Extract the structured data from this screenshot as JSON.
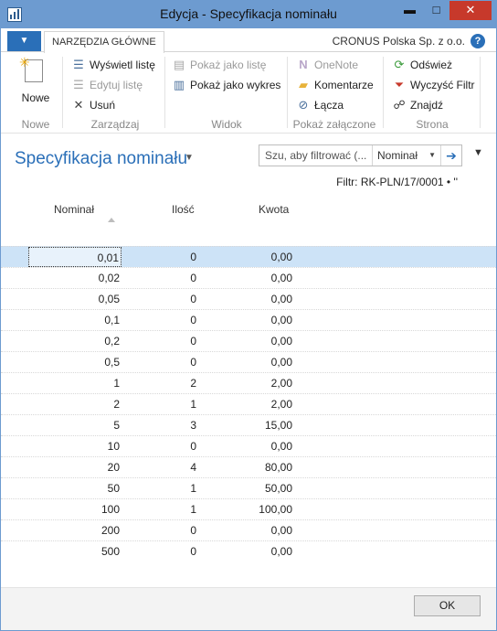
{
  "window": {
    "title": "Edycja - Specyfikacja nominału",
    "minimize": "▬",
    "maximize": "□",
    "close": "✕"
  },
  "ribbon": {
    "app_menu_icon": "▼",
    "tab": "NARZĘDZIA GŁÓWNE",
    "company": "CRONUS Polska Sp. z o.o.",
    "help": "?",
    "groups": {
      "new": {
        "label": "Nowe",
        "new_button": "Nowe"
      },
      "manage": {
        "label": "Zarządzaj",
        "view_list": "Wyświetl listę",
        "edit_list": "Edytuj listę",
        "delete": "Usuń"
      },
      "view": {
        "label": "Widok",
        "show_as_list": "Pokaż jako listę",
        "show_as_chart": "Pokaż jako wykres"
      },
      "attachments": {
        "label": "Pokaż załączone",
        "onenote": "OneNote",
        "comments": "Komentarze",
        "links": "Łącza"
      },
      "page": {
        "label": "Strona",
        "refresh": "Odśwież",
        "clear_filter": "Wyczyść Filtr",
        "find": "Znajdź"
      }
    }
  },
  "page": {
    "title": "Specyfikacja nominału",
    "filter_placeholder": "Szu, aby filtrować (...",
    "filter_field": "Nominał",
    "filter_text": "Filtr: RK-PLN/17/0001 • ''"
  },
  "table": {
    "columns": [
      "Nominał",
      "Ilość",
      "Kwota"
    ],
    "rows": [
      {
        "nominal": "0,01",
        "qty": "0",
        "amount": "0,00"
      },
      {
        "nominal": "0,02",
        "qty": "0",
        "amount": "0,00"
      },
      {
        "nominal": "0,05",
        "qty": "0",
        "amount": "0,00"
      },
      {
        "nominal": "0,1",
        "qty": "0",
        "amount": "0,00"
      },
      {
        "nominal": "0,2",
        "qty": "0",
        "amount": "0,00"
      },
      {
        "nominal": "0,5",
        "qty": "0",
        "amount": "0,00"
      },
      {
        "nominal": "1",
        "qty": "2",
        "amount": "2,00"
      },
      {
        "nominal": "2",
        "qty": "1",
        "amount": "2,00"
      },
      {
        "nominal": "5",
        "qty": "3",
        "amount": "15,00"
      },
      {
        "nominal": "10",
        "qty": "0",
        "amount": "0,00"
      },
      {
        "nominal": "20",
        "qty": "4",
        "amount": "80,00"
      },
      {
        "nominal": "50",
        "qty": "1",
        "amount": "50,00"
      },
      {
        "nominal": "100",
        "qty": "1",
        "amount": "100,00"
      },
      {
        "nominal": "200",
        "qty": "0",
        "amount": "0,00"
      },
      {
        "nominal": "500",
        "qty": "0",
        "amount": "0,00"
      }
    ]
  },
  "footer": {
    "ok": "OK"
  },
  "colors": {
    "accent": "#2a6fb8",
    "titlebar": "#6d9bd0",
    "selected_row": "#cde3f7",
    "close": "#c7392b"
  }
}
